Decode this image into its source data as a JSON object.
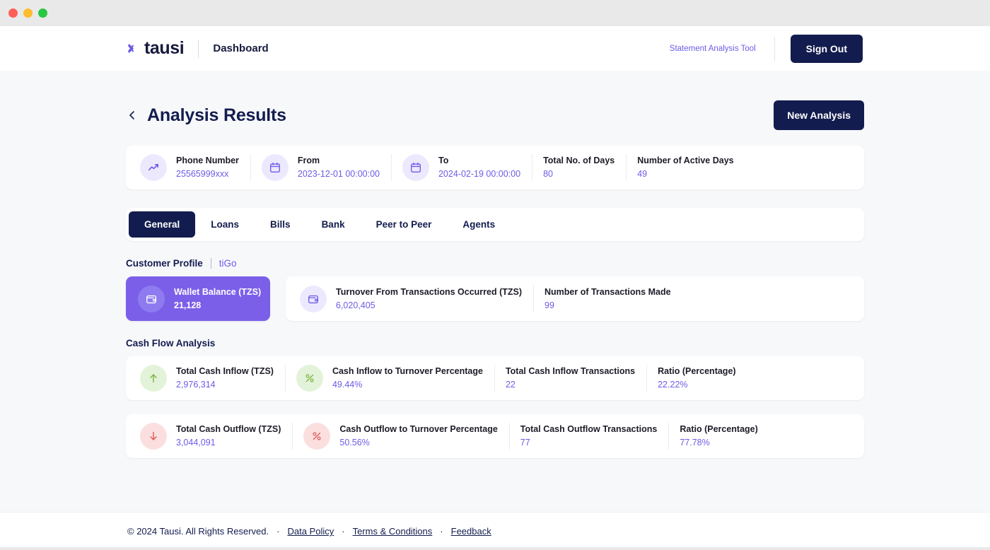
{
  "window": {
    "traffic_lights": [
      "close",
      "minimize",
      "maximize"
    ]
  },
  "topnav": {
    "brand": "tausi",
    "page_label": "Dashboard",
    "tool_link": "Statement Analysis Tool",
    "signout_label": "Sign Out"
  },
  "page": {
    "title": "Analysis Results",
    "new_analysis_label": "New Analysis"
  },
  "summary": [
    {
      "label": "Phone Number",
      "value": "25565999xxx",
      "icon": "trending-up-icon",
      "icon_style": "lilac"
    },
    {
      "label": "From",
      "value": "2023-12-01 00:00:00",
      "icon": "calendar-icon",
      "icon_style": "lilac"
    },
    {
      "label": "To",
      "value": "2024-02-19 00:00:00",
      "icon": "calendar-icon",
      "icon_style": "lilac"
    },
    {
      "label": "Total No. of Days",
      "value": "80",
      "icon": "",
      "icon_style": ""
    },
    {
      "label": "Number of Active Days",
      "value": "49",
      "icon": "",
      "icon_style": ""
    }
  ],
  "tabs": [
    {
      "label": "General",
      "active": true
    },
    {
      "label": "Loans",
      "active": false
    },
    {
      "label": "Bills",
      "active": false
    },
    {
      "label": "Bank",
      "active": false
    },
    {
      "label": "Peer to Peer",
      "active": false
    },
    {
      "label": "Agents",
      "active": false
    }
  ],
  "customer_profile": {
    "title": "Customer Profile",
    "provider": "tiGo",
    "wallet": {
      "label": "Wallet Balance (TZS)",
      "value": "21,128",
      "icon": "wallet-icon"
    },
    "turnover": [
      {
        "label": "Turnover From Transactions Occurred (TZS)",
        "value": "6,020,405",
        "icon": "wallet-icon",
        "icon_style": "lilac"
      },
      {
        "label": "Number of Transactions Made",
        "value": "99",
        "icon": "",
        "icon_style": ""
      }
    ]
  },
  "cash_flow": {
    "title": "Cash Flow Analysis",
    "inflow": [
      {
        "label": "Total Cash Inflow (TZS)",
        "value": "2,976,314",
        "icon": "arrow-up-icon",
        "icon_style": "green"
      },
      {
        "label": "Cash Inflow to Turnover Percentage",
        "value": "49.44%",
        "icon": "percent-icon",
        "icon_style": "green"
      },
      {
        "label": "Total Cash Inflow Transactions",
        "value": "22",
        "icon": "",
        "icon_style": ""
      },
      {
        "label": "Ratio (Percentage)",
        "value": "22.22%",
        "icon": "",
        "icon_style": ""
      }
    ],
    "outflow": [
      {
        "label": "Total Cash Outflow (TZS)",
        "value": "3,044,091",
        "icon": "arrow-down-icon",
        "icon_style": "red"
      },
      {
        "label": "Cash Outflow to Turnover Percentage",
        "value": "50.56%",
        "icon": "percent-icon",
        "icon_style": "red"
      },
      {
        "label": "Total Cash Outflow Transactions",
        "value": "77",
        "icon": "",
        "icon_style": ""
      },
      {
        "label": "Ratio (Percentage)",
        "value": "77.78%",
        "icon": "",
        "icon_style": ""
      }
    ]
  },
  "footer": {
    "copyright": "© 2024 Tausi. All Rights Reserved.",
    "separator": "·",
    "links": [
      "Data Policy",
      "Terms & Conditions",
      "Feedback"
    ]
  },
  "colors": {
    "brand_navy": "#131c4e",
    "accent_purple": "#6c5ce7",
    "wallet_purple": "#7b5fe8",
    "inflow_green": "#7cb342",
    "outflow_red": "#e05a5a",
    "page_bg": "#f7f8fa"
  }
}
